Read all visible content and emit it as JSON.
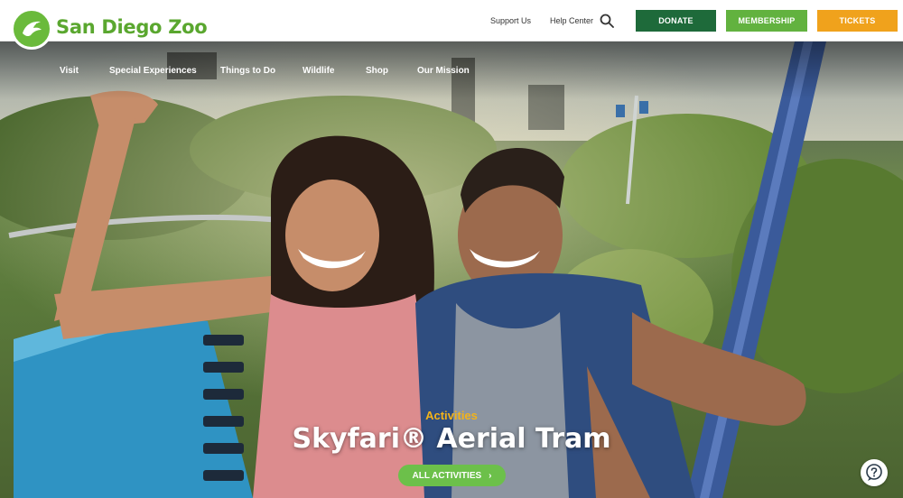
{
  "brand": {
    "name": "San Diego Zoo",
    "color": "#5aa72f"
  },
  "utility": {
    "support": "Support Us",
    "help": "Help Center"
  },
  "cta": {
    "donate": {
      "label": "DONATE",
      "color": "#1e6a3a"
    },
    "membership": {
      "label": "MEMBERSHIP",
      "color": "#62b23f"
    },
    "tickets": {
      "label": "TICKETS",
      "color": "#f0a21c"
    }
  },
  "nav": [
    "Visit",
    "Special Experiences",
    "Things to Do",
    "Wildlife",
    "Shop",
    "Our Mission"
  ],
  "hero": {
    "kicker": "Activities",
    "title": "Skyfari® Aerial Tram",
    "button": "ALL ACTIVITIES",
    "button_arrow": "›"
  },
  "icons": {
    "search": "search-icon",
    "help": "help-chat-icon",
    "logo": "eagle-logo-icon"
  }
}
